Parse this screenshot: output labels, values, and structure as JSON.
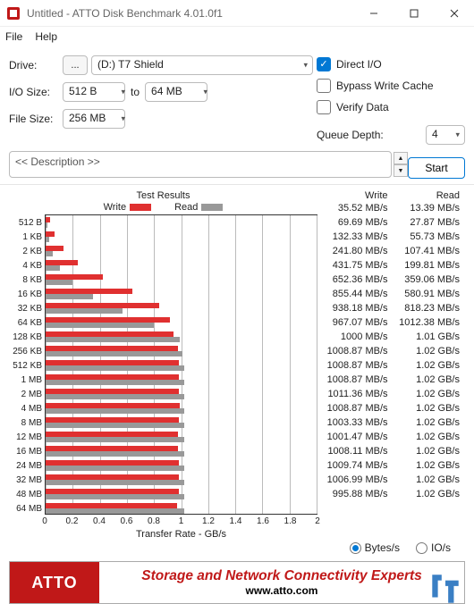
{
  "window": {
    "title": "Untitled - ATTO Disk Benchmark 4.01.0f1"
  },
  "menu": {
    "file": "File",
    "help": "Help"
  },
  "form": {
    "drive_label": "Drive:",
    "browse": "...",
    "drive_value": "(D:) T7 Shield",
    "iosize_label": "I/O Size:",
    "iosize_from": "512 B",
    "iosize_to_label": "to",
    "iosize_to": "64 MB",
    "filesize_label": "File Size:",
    "filesize_value": "256 MB",
    "desc": "<< Description >>"
  },
  "opts": {
    "direct_io": "Direct I/O",
    "bypass": "Bypass Write Cache",
    "verify": "Verify Data",
    "qd_label": "Queue Depth:",
    "qd_value": "4",
    "start": "Start"
  },
  "chart": {
    "title": "Test Results",
    "write_label": "Write",
    "read_label": "Read",
    "xaxis_title": "Transfer Rate - GB/s",
    "colors": {
      "write": "#e03030",
      "read": "#999999"
    }
  },
  "chart_data": {
    "type": "bar",
    "orientation": "horizontal",
    "xlabel": "Transfer Rate - GB/s",
    "xlim": [
      0,
      2
    ],
    "xticks": [
      0,
      0.2,
      0.4,
      0.6,
      0.8,
      1,
      1.2,
      1.4,
      1.6,
      1.8,
      2
    ],
    "categories": [
      "512 B",
      "1 KB",
      "2 KB",
      "4 KB",
      "8 KB",
      "16 KB",
      "32 KB",
      "64 KB",
      "128 KB",
      "256 KB",
      "512 KB",
      "1 MB",
      "2 MB",
      "4 MB",
      "8 MB",
      "12 MB",
      "16 MB",
      "24 MB",
      "32 MB",
      "48 MB",
      "64 MB"
    ],
    "series": [
      {
        "name": "Write",
        "unit": "MB/s",
        "values_mb_s": [
          35.52,
          69.69,
          132.33,
          241.8,
          431.75,
          652.36,
          855.44,
          938.18,
          967.07,
          1000,
          1008.87,
          1008.87,
          1008.87,
          1011.36,
          1008.87,
          1003.33,
          1001.47,
          1008.11,
          1009.74,
          1006.99,
          995.88
        ]
      },
      {
        "name": "Read",
        "unit": "MB/s",
        "values_mb_s": [
          13.39,
          27.87,
          55.73,
          107.41,
          199.81,
          359.06,
          580.91,
          818.23,
          1012.38,
          1034.24,
          1044.48,
          1044.48,
          1044.48,
          1044.48,
          1044.48,
          1044.48,
          1044.48,
          1044.48,
          1044.48,
          1044.48,
          1044.48
        ]
      }
    ]
  },
  "table": {
    "head_write": "Write",
    "head_read": "Read",
    "rows": [
      {
        "w": "35.52 MB/s",
        "r": "13.39 MB/s"
      },
      {
        "w": "69.69 MB/s",
        "r": "27.87 MB/s"
      },
      {
        "w": "132.33 MB/s",
        "r": "55.73 MB/s"
      },
      {
        "w": "241.80 MB/s",
        "r": "107.41 MB/s"
      },
      {
        "w": "431.75 MB/s",
        "r": "199.81 MB/s"
      },
      {
        "w": "652.36 MB/s",
        "r": "359.06 MB/s"
      },
      {
        "w": "855.44 MB/s",
        "r": "580.91 MB/s"
      },
      {
        "w": "938.18 MB/s",
        "r": "818.23 MB/s"
      },
      {
        "w": "967.07 MB/s",
        "r": "1012.38 MB/s"
      },
      {
        "w": "1000 MB/s",
        "r": "1.01 GB/s"
      },
      {
        "w": "1008.87 MB/s",
        "r": "1.02 GB/s"
      },
      {
        "w": "1008.87 MB/s",
        "r": "1.02 GB/s"
      },
      {
        "w": "1008.87 MB/s",
        "r": "1.02 GB/s"
      },
      {
        "w": "1011.36 MB/s",
        "r": "1.02 GB/s"
      },
      {
        "w": "1008.87 MB/s",
        "r": "1.02 GB/s"
      },
      {
        "w": "1003.33 MB/s",
        "r": "1.02 GB/s"
      },
      {
        "w": "1001.47 MB/s",
        "r": "1.02 GB/s"
      },
      {
        "w": "1008.11 MB/s",
        "r": "1.02 GB/s"
      },
      {
        "w": "1009.74 MB/s",
        "r": "1.02 GB/s"
      },
      {
        "w": "1006.99 MB/s",
        "r": "1.02 GB/s"
      },
      {
        "w": "995.88 MB/s",
        "r": "1.02 GB/s"
      }
    ]
  },
  "footer": {
    "bytes": "Bytes/s",
    "io": "IO/s"
  },
  "banner": {
    "brand": "ATTO",
    "tagline": "Storage and Network Connectivity Experts",
    "url": "www.atto.com"
  }
}
